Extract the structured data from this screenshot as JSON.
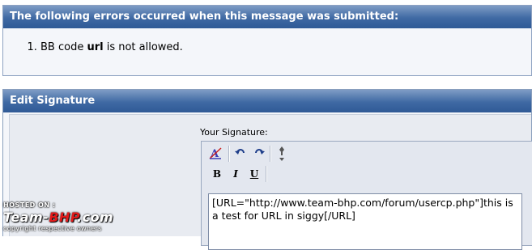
{
  "errors": {
    "title": "The following errors occurred when this message was submitted:",
    "items": [
      {
        "number": "1.",
        "prefix": "BB code ",
        "code": "url",
        "suffix": " is not allowed."
      }
    ]
  },
  "edit_signature": {
    "title": "Edit Signature",
    "signature_label": "Your Signature:",
    "toolbar": {
      "format_icon": "remove-format-icon",
      "undo_icon": "undo-icon",
      "redo_icon": "redo-icon",
      "resize_icon": "resize-toggle-icon",
      "bold_label": "B",
      "italic_label": "I",
      "underline_label": "U"
    },
    "textarea_value": "[URL=\"http://www.team-bhp.com/forum/usercp.php\"]this is a test for URL in siggy[/URL]"
  },
  "watermark": {
    "hosted_on": "HOSTED ON :",
    "brand_part1": "Team-",
    "brand_part2": "BHP",
    "brand_part3": ".com",
    "copyright": "copyright respective owners"
  },
  "colors": {
    "header_gradient_top": "#7e9cc5",
    "header_gradient_bottom": "#2f5a96",
    "panel_background": "#f4f6fa",
    "brand_red": "#e21c1c"
  }
}
